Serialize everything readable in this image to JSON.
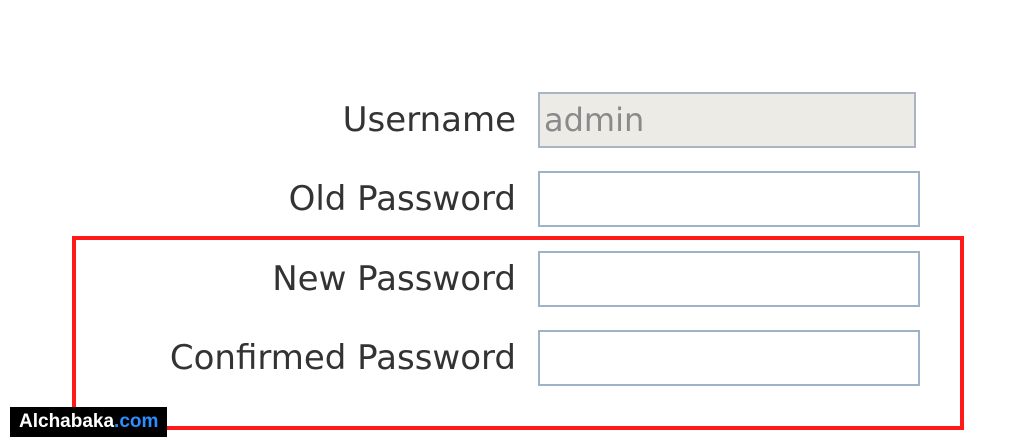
{
  "form": {
    "username": {
      "label": "Username",
      "value": "admin"
    },
    "old_password": {
      "label": "Old Password",
      "value": ""
    },
    "new_password": {
      "label": "New Password",
      "value": ""
    },
    "confirmed_password": {
      "label": "Confirmed Password",
      "value": ""
    }
  },
  "highlight": {
    "color": "#ff1a1a"
  },
  "watermark": {
    "name": "Alchabaka",
    "tld": ".com"
  }
}
